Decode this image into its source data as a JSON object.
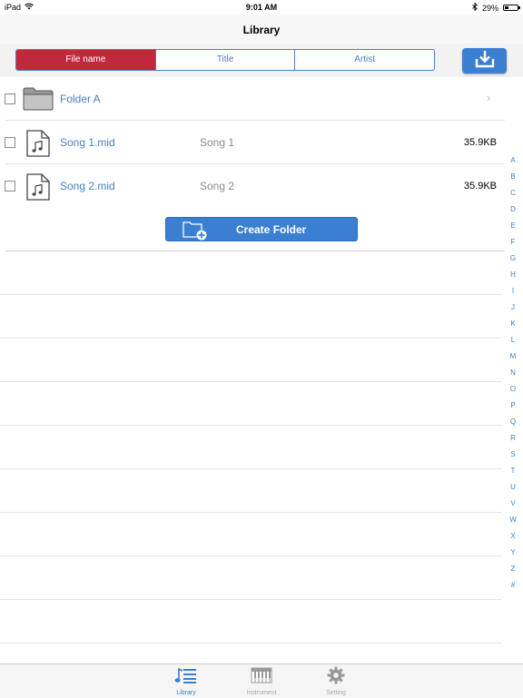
{
  "status_bar": {
    "device": "iPad",
    "time": "9:01 AM",
    "battery": "29%",
    "battery_level": 0.29
  },
  "nav": {
    "title": "Library"
  },
  "sort_tabs": [
    {
      "label": "File name",
      "active": true
    },
    {
      "label": "Title",
      "active": false
    },
    {
      "label": "Artist",
      "active": false
    }
  ],
  "download_button": {
    "icon": "download-icon"
  },
  "items": [
    {
      "type": "folder",
      "name": "Folder A",
      "title": "",
      "size": "",
      "icon": "folder-icon",
      "chevron": "›"
    },
    {
      "type": "file",
      "name": "Song 1.mid",
      "title": "Song 1",
      "size": "35.9KB",
      "icon": "music-file-icon"
    },
    {
      "type": "file",
      "name": "Song 2.mid",
      "title": "Song 2",
      "size": "35.9KB",
      "icon": "music-file-icon"
    }
  ],
  "create_folder": {
    "label": "Create Folder",
    "icon": "add-folder-icon"
  },
  "index_letters": [
    "A",
    "B",
    "C",
    "D",
    "E",
    "F",
    "G",
    "H",
    "I",
    "J",
    "K",
    "L",
    "M",
    "N",
    "O",
    "P",
    "Q",
    "R",
    "S",
    "T",
    "U",
    "V",
    "W",
    "X",
    "Y",
    "Z",
    "#"
  ],
  "tabbar": [
    {
      "label": "Library",
      "icon": "library-icon",
      "active": true
    },
    {
      "label": "Instrument",
      "icon": "piano-icon",
      "active": false
    },
    {
      "label": "Setting",
      "icon": "gear-icon",
      "active": false
    }
  ],
  "colors": {
    "accent": "#3b7fd0",
    "active_segment": "#c0283d",
    "link_text": "#4a7fc1"
  }
}
